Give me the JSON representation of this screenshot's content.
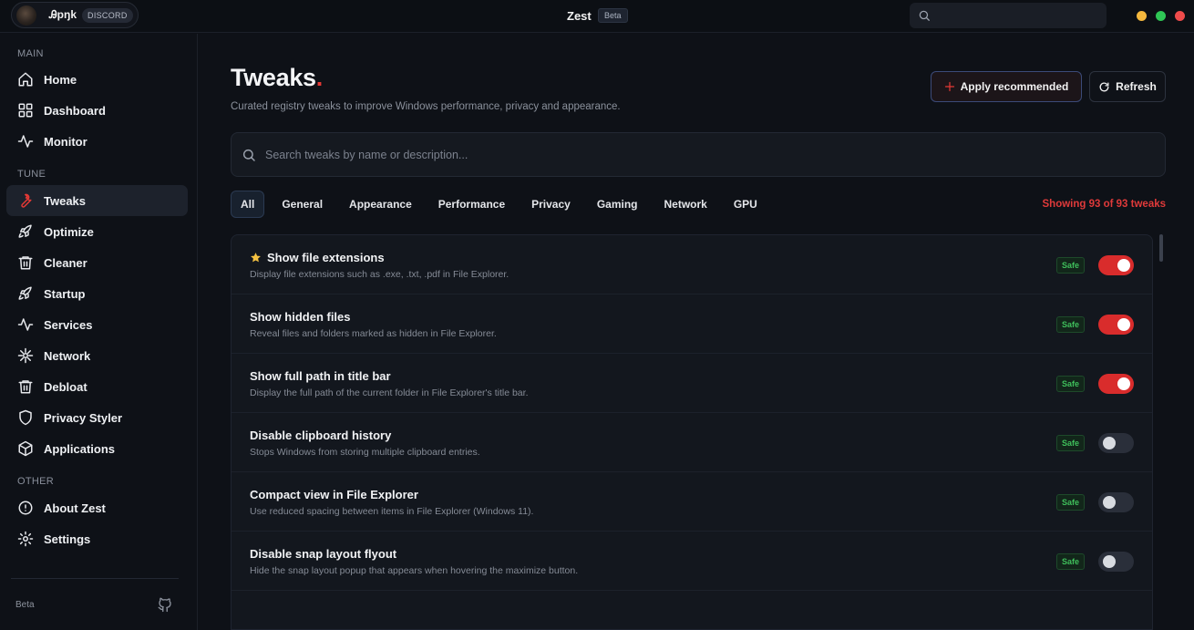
{
  "topbar": {
    "username": "Ꭿpŋk",
    "discord_badge": "DISCORD",
    "app_title": "Zest",
    "beta_badge": "Beta",
    "search_placeholder": ""
  },
  "sidebar": {
    "sections": [
      {
        "label": "MAIN",
        "items": [
          {
            "label": "Home",
            "icon": "home-icon"
          },
          {
            "label": "Dashboard",
            "icon": "grid-icon"
          },
          {
            "label": "Monitor",
            "icon": "activity-icon"
          }
        ]
      },
      {
        "label": "TUNE",
        "items": [
          {
            "label": "Tweaks",
            "icon": "wrench-icon",
            "active": true
          },
          {
            "label": "Optimize",
            "icon": "rocket-icon"
          },
          {
            "label": "Cleaner",
            "icon": "trash-icon"
          },
          {
            "label": "Startup",
            "icon": "rocket-icon"
          },
          {
            "label": "Services",
            "icon": "activity-icon"
          },
          {
            "label": "Network",
            "icon": "network-icon"
          },
          {
            "label": "Debloat",
            "icon": "trash-icon"
          },
          {
            "label": "Privacy Styler",
            "icon": "shield-icon"
          },
          {
            "label": "Applications",
            "icon": "box-icon"
          }
        ]
      },
      {
        "label": "OTHER",
        "items": [
          {
            "label": "About Zest",
            "icon": "info-icon"
          },
          {
            "label": "Settings",
            "icon": "gear-icon"
          }
        ]
      }
    ],
    "footer_label": "Beta"
  },
  "main": {
    "title": "Tweaks",
    "title_accent": ".",
    "subtitle": "Curated registry tweaks to improve Windows performance, privacy and appearance.",
    "apply_label": "Apply recommended",
    "refresh_label": "Refresh",
    "search_placeholder": "Search tweaks by name or description...",
    "tabs": [
      "All",
      "General",
      "Appearance",
      "Performance",
      "Privacy",
      "Gaming",
      "Network",
      "GPU"
    ],
    "active_tab": "All",
    "showing_text": "Showing 93 of 93 tweaks",
    "tweaks": [
      {
        "title": "Show file extensions",
        "desc": "Display file extensions such as .exe, .txt, .pdf in File Explorer.",
        "badge": "Safe",
        "enabled": true,
        "recommended": true
      },
      {
        "title": "Show hidden files",
        "desc": "Reveal files and folders marked as hidden in File Explorer.",
        "badge": "Safe",
        "enabled": true,
        "recommended": false
      },
      {
        "title": "Show full path in title bar",
        "desc": "Display the full path of the current folder in File Explorer's title bar.",
        "badge": "Safe",
        "enabled": true,
        "recommended": false
      },
      {
        "title": "Disable clipboard history",
        "desc": "Stops Windows from storing multiple clipboard entries.",
        "badge": "Safe",
        "enabled": false,
        "recommended": false
      },
      {
        "title": "Compact view in File Explorer",
        "desc": "Use reduced spacing between items in File Explorer (Windows 11).",
        "badge": "Safe",
        "enabled": false,
        "recommended": false
      },
      {
        "title": "Disable snap layout flyout",
        "desc": "Hide the snap layout popup that appears when hovering the maximize button.",
        "badge": "Safe",
        "enabled": false,
        "recommended": false
      }
    ]
  },
  "colors": {
    "accent": "#e53935",
    "toggle_on": "#d92c2c",
    "safe_green": "#3fbf5b",
    "background": "#0e1117"
  }
}
